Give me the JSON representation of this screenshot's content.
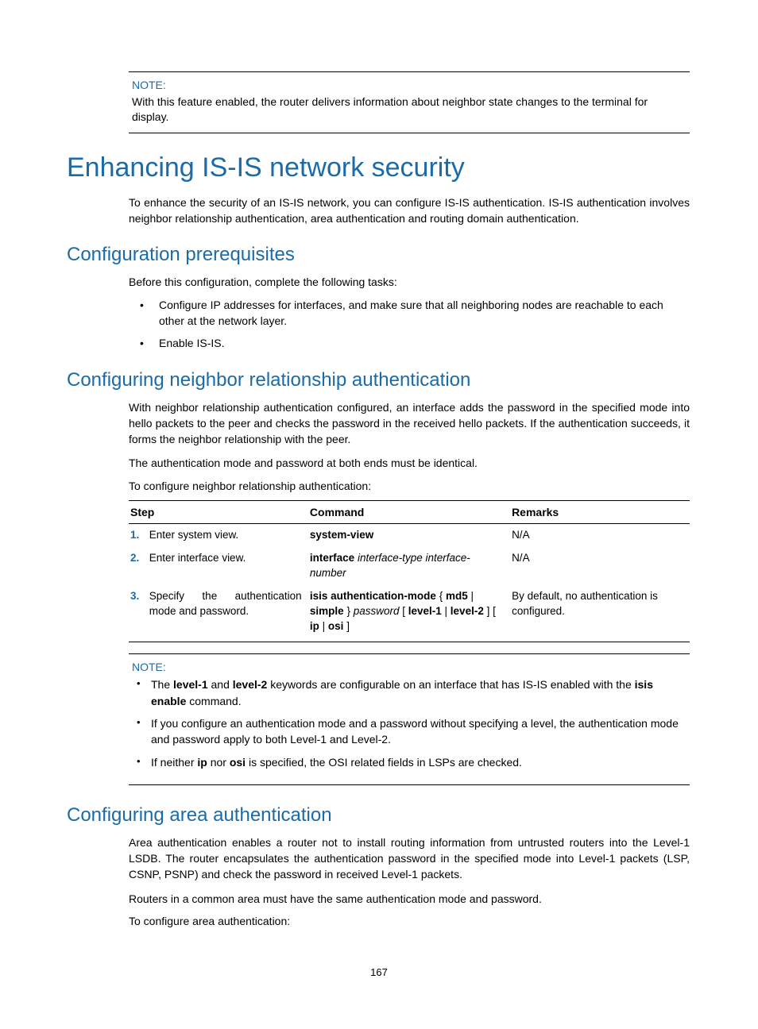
{
  "note1": {
    "label": "NOTE:",
    "text": "With this feature enabled, the router delivers information about neighbor state changes to the terminal for display."
  },
  "h1": "Enhancing IS-IS network security",
  "intro": "To enhance the security of an IS-IS network, you can configure IS-IS authentication. IS-IS authentication involves neighbor relationship authentication, area authentication and routing domain authentication.",
  "prereq": {
    "heading": "Configuration prerequisites",
    "lead": "Before this configuration, complete the following tasks:",
    "items": [
      "Configure IP addresses for interfaces, and make sure that all neighboring nodes are reachable to each other at the network layer.",
      "Enable IS-IS."
    ]
  },
  "neighbor": {
    "heading": "Configuring neighbor relationship authentication",
    "p1": "With neighbor relationship authentication configured, an interface adds the password in the specified mode into hello packets to the peer and checks the password in the received hello packets. If the authentication succeeds, it forms the neighbor relationship with the peer.",
    "p2": "The authentication mode and password at both ends must be identical.",
    "p3": "To configure neighbor relationship authentication:"
  },
  "table": {
    "headers": {
      "step": "Step",
      "command": "Command",
      "remarks": "Remarks"
    },
    "rows": [
      {
        "num": "1.",
        "step": "Enter system view.",
        "cmd_bold": "system-view",
        "remarks": "N/A"
      },
      {
        "num": "2.",
        "step": "Enter interface view.",
        "cmd_bold": "interface",
        "cmd_italic": " interface-type interface-number",
        "remarks": "N/A"
      },
      {
        "num": "3.",
        "step": "Specify the authentication mode and password.",
        "remarks": "By default, no authentication is configured."
      }
    ]
  },
  "cmd3_parts": {
    "p1": "isis authentication-mode",
    "p2": " { ",
    "p3": "md5",
    "p4": " | ",
    "p5": "simple",
    "p6": " } ",
    "p7": "password",
    "p8": " [ ",
    "p9": "level-1",
    "p10": " | ",
    "p11": "level-2",
    "p12": " ] [ ",
    "p13": "ip",
    "p14": " | ",
    "p15": "osi",
    "p16": " ]"
  },
  "note2": {
    "label": "NOTE:",
    "b1a": "The ",
    "b1b": "level-1",
    "b1c": " and ",
    "b1d": "level-2",
    "b1e": " keywords are configurable on an interface that has IS-IS enabled with the ",
    "b1f": "isis enable",
    "b1g": " command.",
    "b2": "If you configure an authentication mode and a password without specifying a level, the authentication mode and password apply to both Level-1 and Level-2.",
    "b3a": "If neither ",
    "b3b": "ip",
    "b3c": " nor ",
    "b3d": "osi",
    "b3e": " is specified, the OSI related fields in LSPs are checked."
  },
  "area": {
    "heading": "Configuring area authentication",
    "p1": "Area authentication enables a router not to install routing information from untrusted routers into the Level-1 LSDB. The router encapsulates the authentication password in the specified mode into Level-1 packets (LSP, CSNP, PSNP) and check the password in received Level-1 packets.",
    "p2": "Routers in a common area must have the same authentication mode and password.",
    "p3": "To configure area authentication:"
  },
  "pageNumber": "167"
}
